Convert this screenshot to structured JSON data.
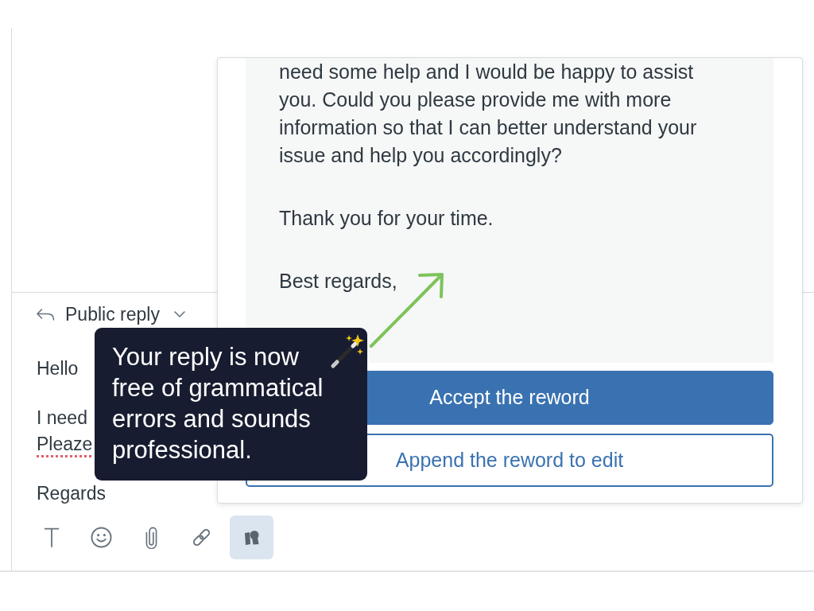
{
  "composer": {
    "reply_mode": "Public reply",
    "paragraphs": [
      {
        "lines": [
          {
            "text": "Hello",
            "misspelled": false
          }
        ]
      },
      {
        "lines": [
          {
            "text": "I need",
            "misspelled": false
          },
          {
            "text": "Pleaze",
            "misspelled": true
          }
        ]
      },
      {
        "lines": [
          {
            "text": "Regards",
            "misspelled": false
          }
        ]
      }
    ],
    "toolbar": [
      {
        "kind": "text",
        "selected": false
      },
      {
        "kind": "emoji",
        "selected": false
      },
      {
        "kind": "attachment",
        "selected": false
      },
      {
        "kind": "link",
        "selected": false
      },
      {
        "kind": "rewrite",
        "selected": true
      }
    ]
  },
  "reword_panel": {
    "paragraphs": [
      "need some help and I would be happy to assist you. Could you please provide me with more information so that I can better understand your issue and help you accordingly?",
      "Thank you for your time.",
      "Best regards,"
    ],
    "buttons": [
      {
        "label": "Accept the reword",
        "kind": "primary"
      },
      {
        "label": "Append the reword to edit",
        "kind": "outline"
      }
    ]
  },
  "tooltip": {
    "text": "Your reply is now free of grammatical errors and sounds professional."
  }
}
